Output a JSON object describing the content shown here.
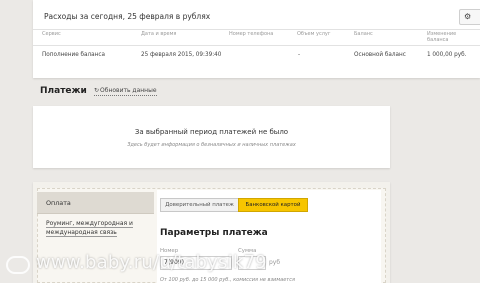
{
  "expenses": {
    "title": "Расходы за сегодня, 25 февраля в рублях",
    "settings_icon": "gear-icon",
    "columns": [
      "Сервис",
      "Дата и время",
      "Номер телефона",
      "Объем услуг",
      "Баланс",
      "Изменение баланса"
    ],
    "row": [
      "Пополнение баланса",
      "25 февраля 2015, 09:39:40",
      "",
      "-",
      "Основной баланс",
      "1 000,00 руб."
    ]
  },
  "payments": {
    "title": "Платежи",
    "refresh_label": "Обновить данные",
    "refresh_icon": "refresh-icon"
  },
  "empty_state": {
    "message": "За выбранный период платежей не было",
    "sub": "Здесь будет информация о безналичных и наличных платежах"
  },
  "pay_panel": {
    "menu": {
      "active": "Оплата",
      "item": "Роуминг, междугородная и международная связь"
    },
    "tabs": [
      "Доверительный платеж",
      "Банковской картой"
    ],
    "params_title": "Параметры платежа",
    "number_label": "Номер",
    "number_value": "7(909)",
    "sum_label": "Сумма",
    "currency": "руб",
    "hint": "От 100 руб. до 15 000 руб., комиссия не взимается"
  },
  "watermark": "www.baby.ru/u/tabysik79"
}
